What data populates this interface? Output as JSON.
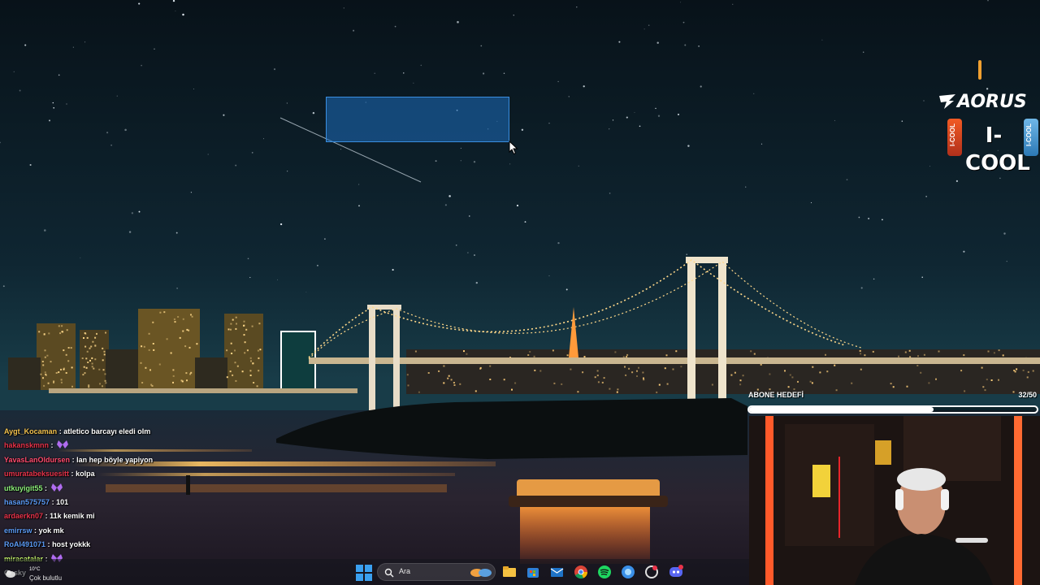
{
  "chat": {
    "messages": [
      {
        "user": "Aygt_Kocaman",
        "sep": ":",
        "text": "atletico barcayı eledi olm",
        "color": "#f2c14e",
        "emote": false
      },
      {
        "user": "hakanskmnn",
        "sep": ":",
        "text": "",
        "color": "#e8334a",
        "emote": true
      },
      {
        "user": "YavasLanOldursen",
        "sep": ":",
        "text": "lan hep böyle yapiyon",
        "color": "#ff4b6e",
        "emote": false
      },
      {
        "user": "umuratabeksuesitt",
        "sep": ":",
        "text": "kolpa",
        "color": "#e8334a",
        "emote": false
      },
      {
        "user": "utkuyigit55",
        "sep": ":",
        "text": "",
        "color": "#8df07a",
        "emote": true
      },
      {
        "user": "hasan575757",
        "sep": ":",
        "text": "101",
        "color": "#5b9bf5",
        "emote": false
      },
      {
        "user": "ardaerkn07",
        "sep": ":",
        "text": "11k kemik mi",
        "color": "#e8334a",
        "emote": false
      },
      {
        "user": "emirrsw",
        "sep": ":",
        "text": "yok mk",
        "color": "#5b9bf5",
        "emote": false
      },
      {
        "user": "RoAl491071",
        "sep": ":",
        "text": "host yokkk",
        "color": "#5b9bf5",
        "emote": false
      },
      {
        "user": "miracatalar",
        "sep": ":",
        "text": "",
        "color": "#c6f56c",
        "emote": true
      },
      {
        "user": "Gasky",
        "sep": "",
        "text": "",
        "color": "#f2f2f2",
        "emote": false
      }
    ]
  },
  "overlay": {
    "sub_goal_label": "ABONE HEDEFİ",
    "sub_goal_count": "32/50",
    "sub_goal_progress": 0.64
  },
  "sponsors": {
    "aorus": "AORUS",
    "icool": "I-COOL",
    "can_label": "I-COOL"
  },
  "taskbar": {
    "weather_temp": "10°C",
    "weather_desc": "Çok bulutlu",
    "search_placeholder": "Ara",
    "apps": [
      {
        "name": "file-explorer",
        "icon": "folder-icon"
      },
      {
        "name": "microsoft-store",
        "icon": "store-icon"
      },
      {
        "name": "mail",
        "icon": "mail-icon"
      },
      {
        "name": "chrome",
        "icon": "chrome-icon"
      },
      {
        "name": "spotify",
        "icon": "spotify-icon"
      },
      {
        "name": "browser",
        "icon": "browser-icon"
      },
      {
        "name": "app-6",
        "icon": "app-icon"
      },
      {
        "name": "discord",
        "icon": "discord-icon"
      }
    ]
  },
  "colors": {
    "sky_top": "#0a1620",
    "sky_bottom": "#173542",
    "bridge_lights": "#ffd27a",
    "selection": "#1e6ebe",
    "start_blue": "#3aa0f0"
  }
}
